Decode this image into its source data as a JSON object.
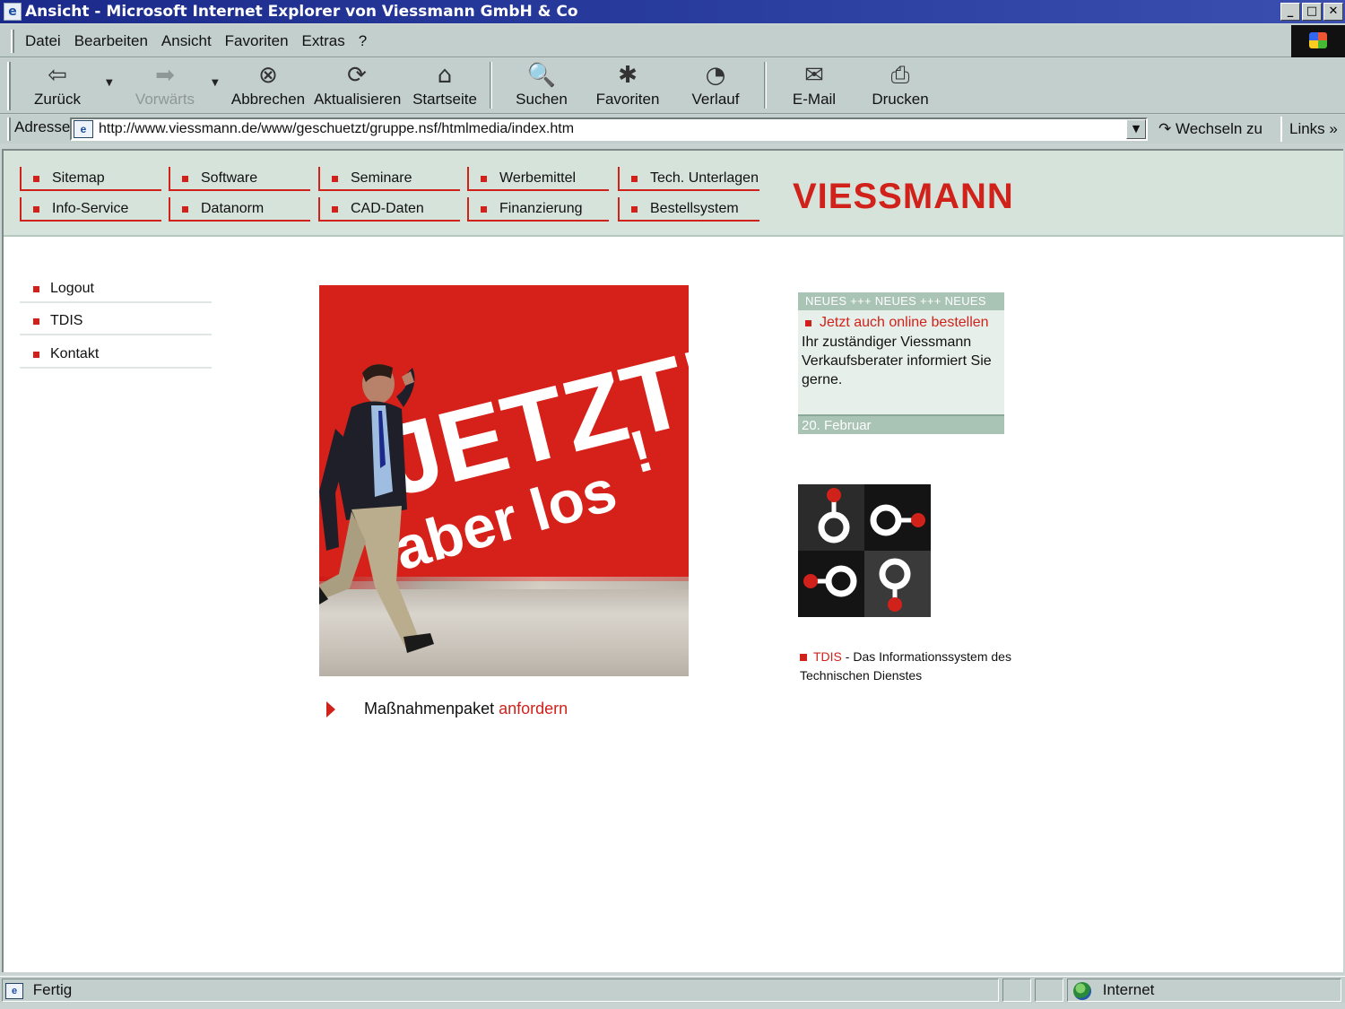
{
  "window": {
    "title": "Ansicht - Microsoft Internet Explorer von Viessmann GmbH & Co",
    "minimize": "_",
    "maximize": "□",
    "close": "✕"
  },
  "menu": [
    "Datei",
    "Bearbeiten",
    "Ansicht",
    "Favoriten",
    "Extras",
    "?"
  ],
  "toolbar": {
    "back": "Zurück",
    "forward": "Vorwärts",
    "stop": "Abbrechen",
    "refresh": "Aktualisieren",
    "home": "Startseite",
    "search": "Suchen",
    "favorites": "Favoriten",
    "history": "Verlauf",
    "mail": "E-Mail",
    "print": "Drucken"
  },
  "addressbar": {
    "label": "Adresse",
    "url": "http://www.viessmann.de/www/geschuetzt/gruppe.nsf/htmlmedia/index.htm",
    "go": "Wechseln zu",
    "links": "Links »"
  },
  "topnav": {
    "row1": [
      "Sitemap",
      "Software",
      "Seminare",
      "Werbemittel",
      "Tech. Unterlagen"
    ],
    "row2": [
      "Info-Service",
      "Datanorm",
      "CAD-Daten",
      "Finanzierung",
      "Bestellsystem"
    ]
  },
  "brand": {
    "logo_text": "VIESSMANN",
    "color": "#d0221b"
  },
  "sidenav": [
    "Logout",
    "TDIS",
    "Kontakt"
  ],
  "hero": {
    "line1": "JETZT!",
    "line2": "aber los",
    "line2_mark": "!"
  },
  "cta": {
    "text": "Maßnahmenpaket",
    "link": "anfordern"
  },
  "news": {
    "header": "NEUES +++ NEUES +++ NEUES",
    "item_link": "Jetzt auch online bestellen",
    "body": "Ihr zuständiger Viessmann Verkaufsberater informiert Sie gerne.",
    "date": "20. Februar"
  },
  "tdis": {
    "name": "TDIS",
    "caption_rest": " - Das Informationssystem des Technischen Dienstes"
  },
  "statusbar": {
    "status": "Fertig",
    "zone": "Internet"
  },
  "colors": {
    "accent": "#d0221b",
    "nav_bg": "#d6e3db",
    "chrome": "#c3cfcc",
    "titlebar": "#1b2a8a"
  }
}
